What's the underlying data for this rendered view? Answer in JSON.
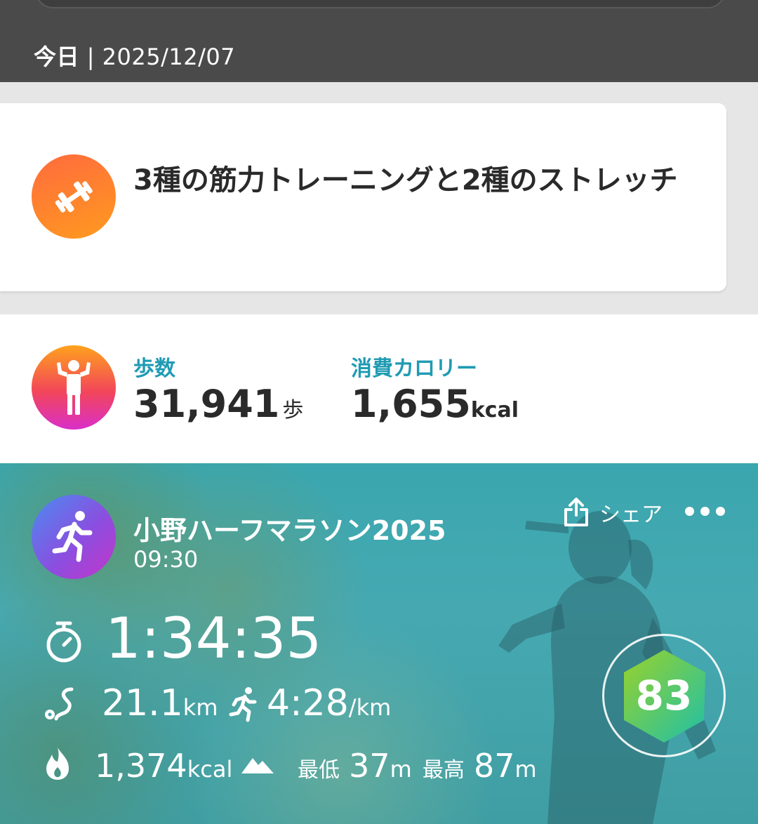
{
  "header": {
    "today_label": "今日",
    "separator": " | ",
    "date": "2025/12/07"
  },
  "training": {
    "icon": "dumbbell-icon",
    "description": "3種の筋力トレーニングと2種のストレッチ"
  },
  "activity": {
    "icon": "person-arms-up-icon",
    "steps_label": "歩数",
    "steps_value": "31,941",
    "steps_unit": "歩",
    "calories_label": "消費カロリー",
    "calories_value": "1,655",
    "calories_unit": "kcal"
  },
  "run": {
    "icon": "running-icon",
    "title": "小野ハーフマラソン2025",
    "start_time": "09:30",
    "share_label": "シェア",
    "duration": "1:34:35",
    "distance_value": "21.1",
    "distance_unit": "km",
    "pace_value": "4:28",
    "pace_unit": "/km",
    "calories_value": "1,374",
    "calories_unit": "kcal",
    "elev_min_label": "最低",
    "elev_min_value": "37",
    "elev_min_unit": "m",
    "elev_max_label": "最高",
    "elev_max_value": "87",
    "elev_max_unit": "m",
    "score": "83",
    "accent_colors": [
      "#2ec4a0",
      "#8ad12f"
    ]
  }
}
